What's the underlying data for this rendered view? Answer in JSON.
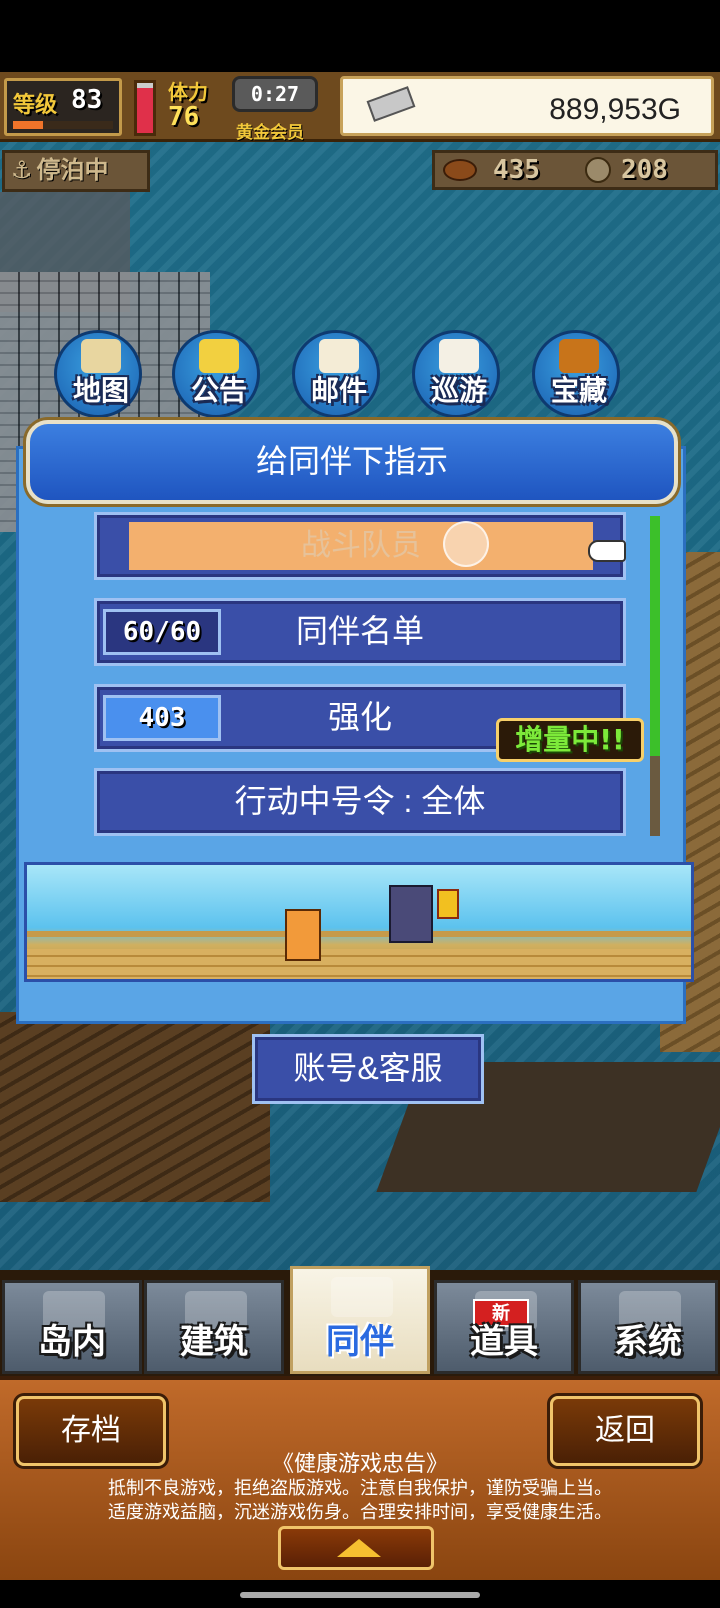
{
  "hud": {
    "level_label": "等级",
    "level": "83",
    "level_progress": 0.3,
    "stamina_label": "体力",
    "stamina": "76",
    "stamina_fill": 0.9,
    "timer": "0:27",
    "membership": "黄金会员",
    "money": "889,953G",
    "status": "停泊中",
    "resource1": "435",
    "resource2": "208"
  },
  "quick_menu": [
    {
      "label": "地图",
      "icon": "map-icon"
    },
    {
      "label": "公告",
      "icon": "signboard-icon"
    },
    {
      "label": "邮件",
      "icon": "mail-icon"
    },
    {
      "label": "巡游",
      "icon": "ship-icon"
    },
    {
      "label": "宝藏",
      "icon": "treasure-chest-icon"
    }
  ],
  "dialog": {
    "title": "给同伴下指示",
    "items": [
      {
        "label": "战斗队员"
      },
      {
        "label": "同伴名单",
        "badge": "60/60"
      },
      {
        "label": "强化",
        "badge": "403",
        "tag": "增量中!!"
      },
      {
        "label": "行动中号令 : 全体"
      }
    ]
  },
  "account_button": "账号&客服",
  "tabs": [
    {
      "label": "岛内",
      "icon": "island-icon"
    },
    {
      "label": "建筑",
      "icon": "hammer-icon"
    },
    {
      "label": "同伴",
      "icon": "companions-icon"
    },
    {
      "label": "道具",
      "icon": "item-bag-icon",
      "badge": "新"
    },
    {
      "label": "系统",
      "icon": "scroll-icon"
    }
  ],
  "footer": {
    "save_label": "存档",
    "back_label": "返回",
    "notice_title": "《健康游戏忠告》",
    "notice_line1": "抵制不良游戏，拒绝盗版游戏。注意自我保护，谨防受骗上当。",
    "notice_line2": "适度游戏益脑，沉迷游戏伤身。合理安排时间，享受健康生活。"
  },
  "colors": {
    "dialog_bg": "#5aa5e6",
    "menu_item_bg": "#3a4fa8",
    "highlight": "#f3b06e",
    "boost_text": "#7dea3a"
  }
}
